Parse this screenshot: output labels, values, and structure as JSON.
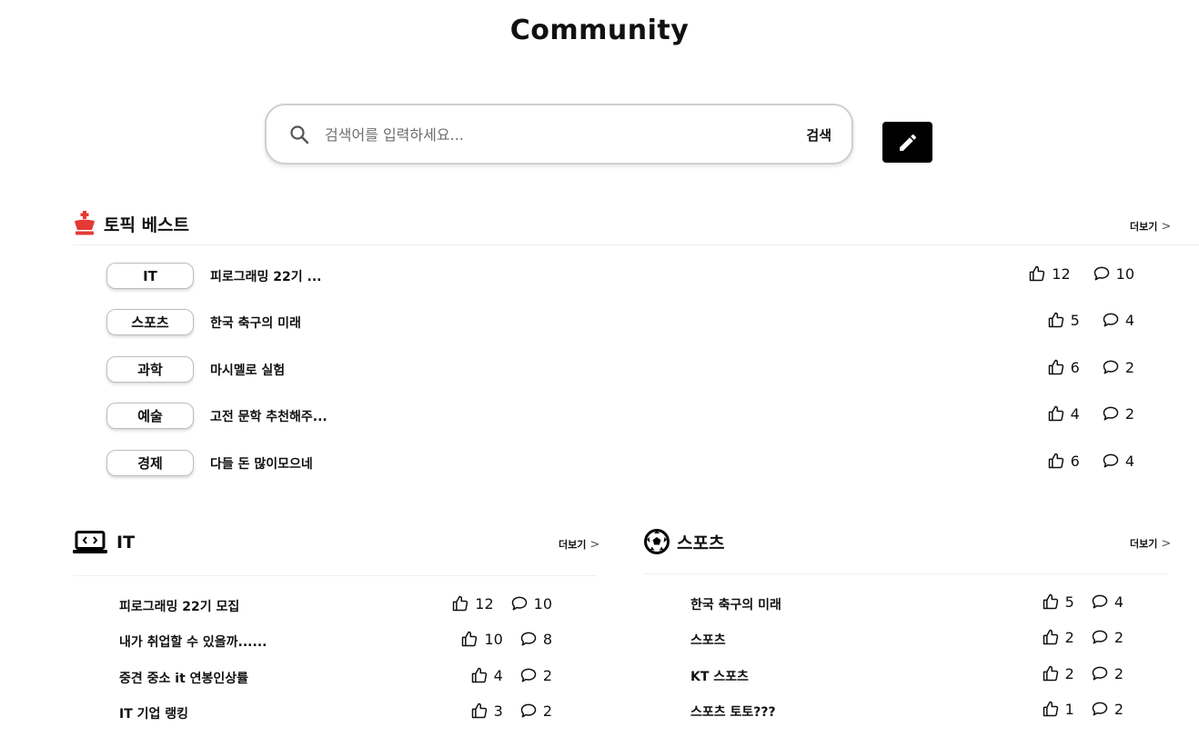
{
  "page": {
    "title": "Community"
  },
  "search": {
    "placeholder": "검색어를 입력하세요...",
    "button_label": "검색"
  },
  "topic_best": {
    "title": "토픽 베스트",
    "more_label": "더보기",
    "rows": [
      {
        "category": "IT",
        "title": "피로그래밍 22기 ...",
        "likes": "12",
        "comments": "10"
      },
      {
        "category": "스포츠",
        "title": "한국 축구의 미래",
        "likes": "5",
        "comments": "4"
      },
      {
        "category": "과학",
        "title": "마시멜로 실험",
        "likes": "6",
        "comments": "2"
      },
      {
        "category": "예술",
        "title": "고전 문학 추천해주...",
        "likes": "4",
        "comments": "2"
      },
      {
        "category": "경제",
        "title": "다들 돈 많이모으네",
        "likes": "6",
        "comments": "4"
      }
    ]
  },
  "it_section": {
    "title": "IT",
    "more_label": "더보기",
    "rows": [
      {
        "title": "피로그래밍 22기 모집",
        "likes": "12",
        "comments": "10"
      },
      {
        "title": "내가 취업할 수 있을까......",
        "likes": "10",
        "comments": "8"
      },
      {
        "title": "중견 중소 it 연봉인상률",
        "likes": "4",
        "comments": "2"
      },
      {
        "title": "IT 기업 랭킹",
        "likes": "3",
        "comments": "2"
      }
    ]
  },
  "sports_section": {
    "title": "스포츠",
    "more_label": "더보기",
    "rows": [
      {
        "title": "한국 축구의 미래",
        "likes": "5",
        "comments": "4"
      },
      {
        "title": "스포츠",
        "likes": "2",
        "comments": "2"
      },
      {
        "title": "KT 스포츠",
        "likes": "2",
        "comments": "2"
      },
      {
        "title": "스포츠 토토???",
        "likes": "1",
        "comments": "2"
      }
    ]
  },
  "icons": {
    "search": "search-icon",
    "write": "pencil-icon",
    "best": "crown-icon",
    "it": "laptop-code-icon",
    "sports": "soccer-ball-icon",
    "like": "thumbs-up-icon",
    "comment": "comment-icon",
    "more": "chevron-right-icon"
  },
  "colors": {
    "accent": "#e53935",
    "primary": "#000000"
  }
}
